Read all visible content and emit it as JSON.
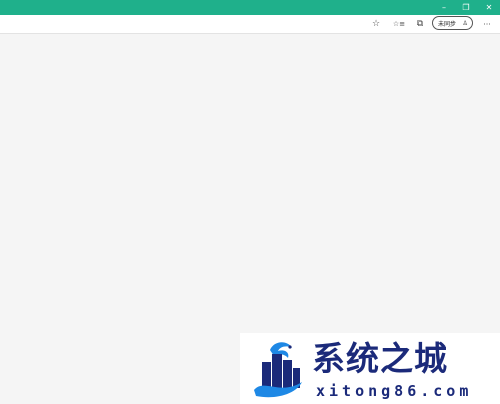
{
  "window": {
    "title_bar_color": "#1fb08b",
    "controls": [
      {
        "name": "minimize",
        "glyph": "–"
      },
      {
        "name": "restore",
        "glyph": "❐"
      },
      {
        "name": "close",
        "glyph": "✕"
      }
    ]
  },
  "toolbar": {
    "favorite_icon": "☆",
    "favorites_icon": "☆≡",
    "collections_icon": "⧉",
    "profile": {
      "label": "未同步",
      "icon": "person-icon",
      "glyph": "♙"
    },
    "more_icon": "···"
  },
  "watermark": {
    "title": "系统之城",
    "url": "xitong86.com",
    "brand_color": "#1b2a7a"
  }
}
